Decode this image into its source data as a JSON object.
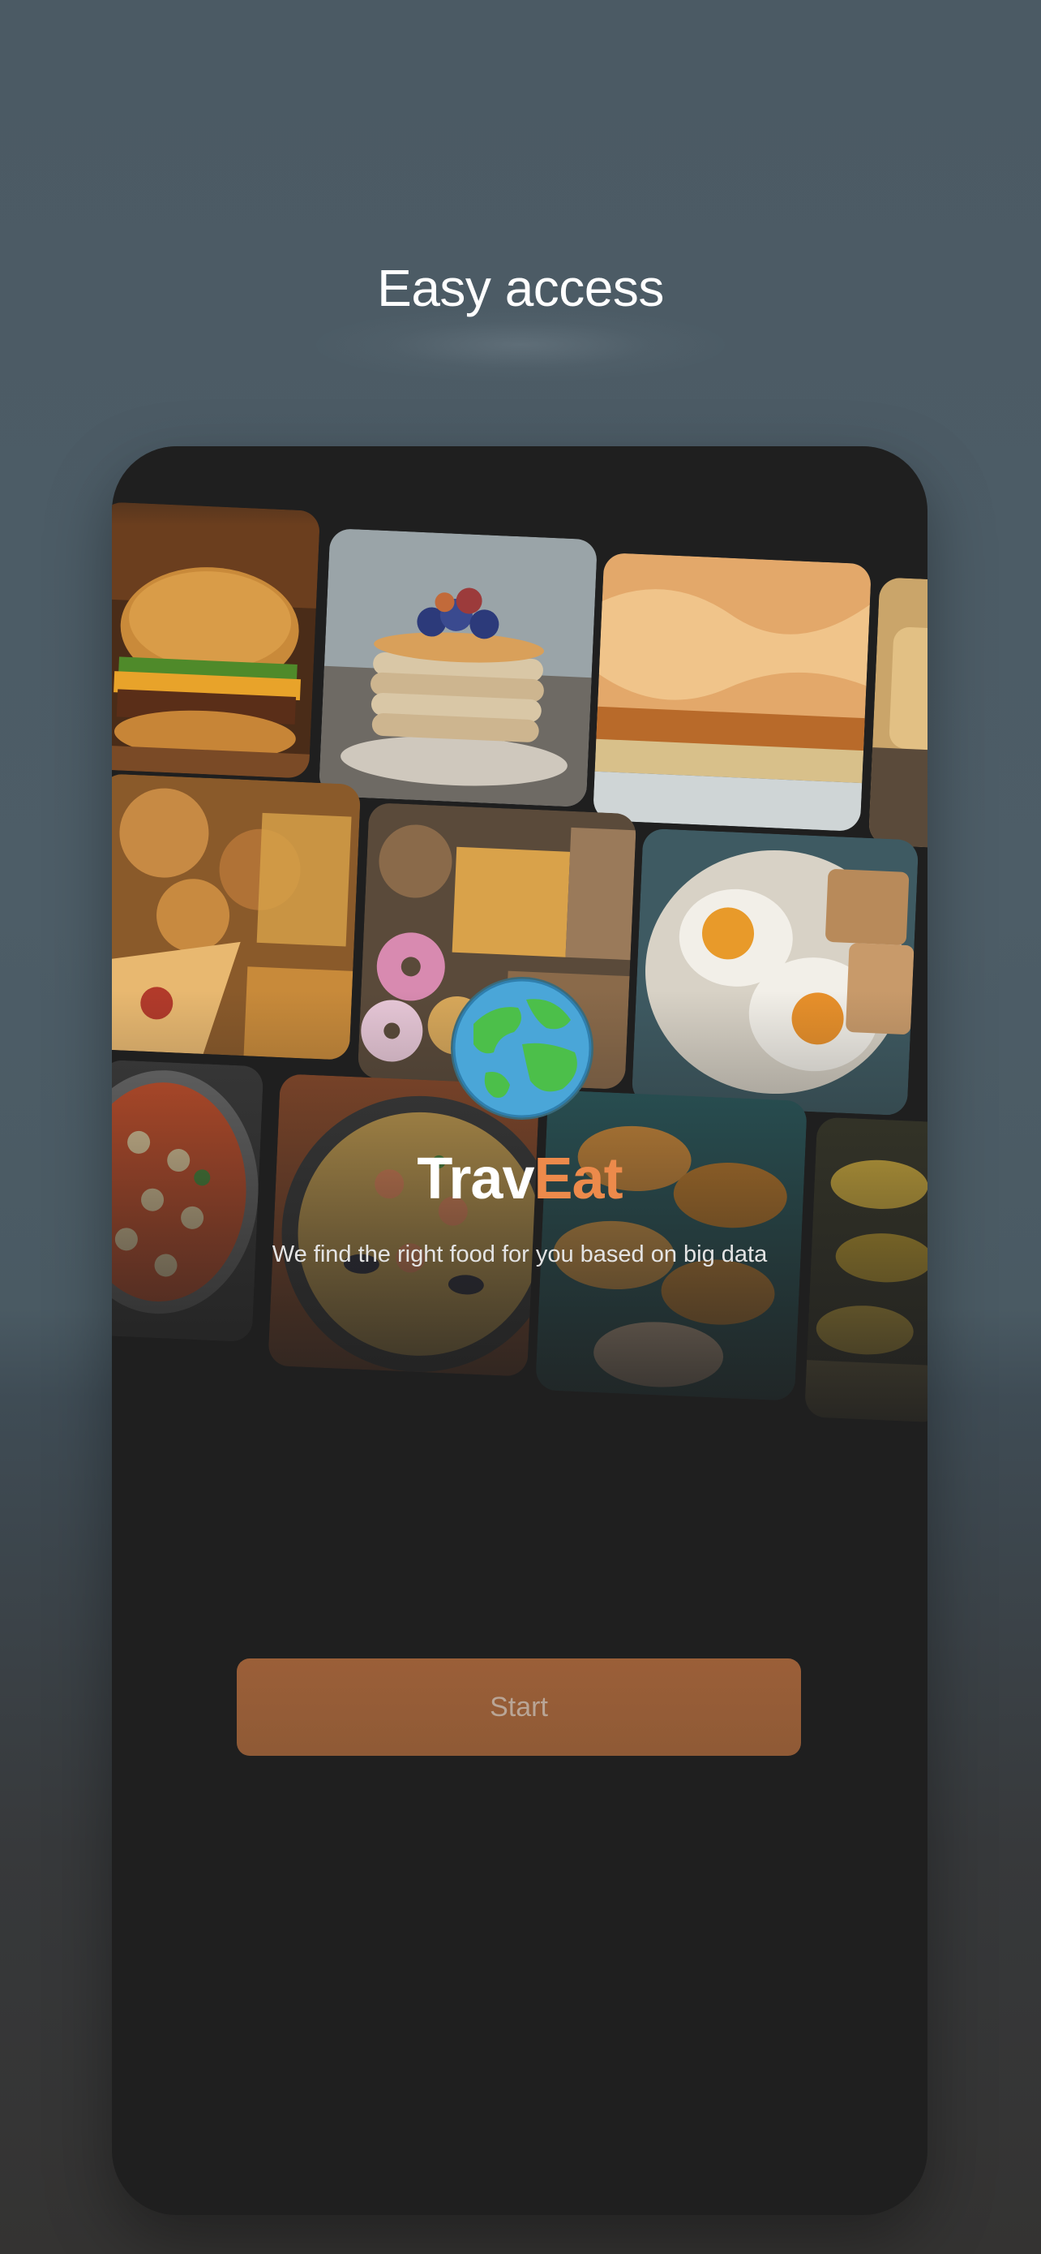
{
  "screen": {
    "headline": "Easy access"
  },
  "app": {
    "brand_part1": "Trav",
    "brand_part2": "Eat",
    "tagline": "We find the right food for you based on big data",
    "start_label": "Start",
    "logo_icon": "globe-icon"
  },
  "collage": {
    "tiles": [
      {
        "name": "burger-photo",
        "kind": "burger"
      },
      {
        "name": "pancakes-photo",
        "kind": "pancakes"
      },
      {
        "name": "pie-photo",
        "kind": "pie"
      },
      {
        "name": "toast-photo",
        "kind": "toast"
      },
      {
        "name": "fast-food-photo",
        "kind": "fastfood"
      },
      {
        "name": "donuts-fries-photo",
        "kind": "donuts"
      },
      {
        "name": "fried-eggs-photo",
        "kind": "eggs"
      },
      {
        "name": "gnocchi-photo",
        "kind": "gnocchi"
      },
      {
        "name": "paella-photo",
        "kind": "paella"
      },
      {
        "name": "empanadas-photo",
        "kind": "empanadas"
      },
      {
        "name": "corn-skewers-photo",
        "kind": "skewers"
      }
    ]
  },
  "colors": {
    "accent": "#ec8a4b",
    "button": "#9b5f38",
    "phone_bg": "#1f1f1f"
  }
}
